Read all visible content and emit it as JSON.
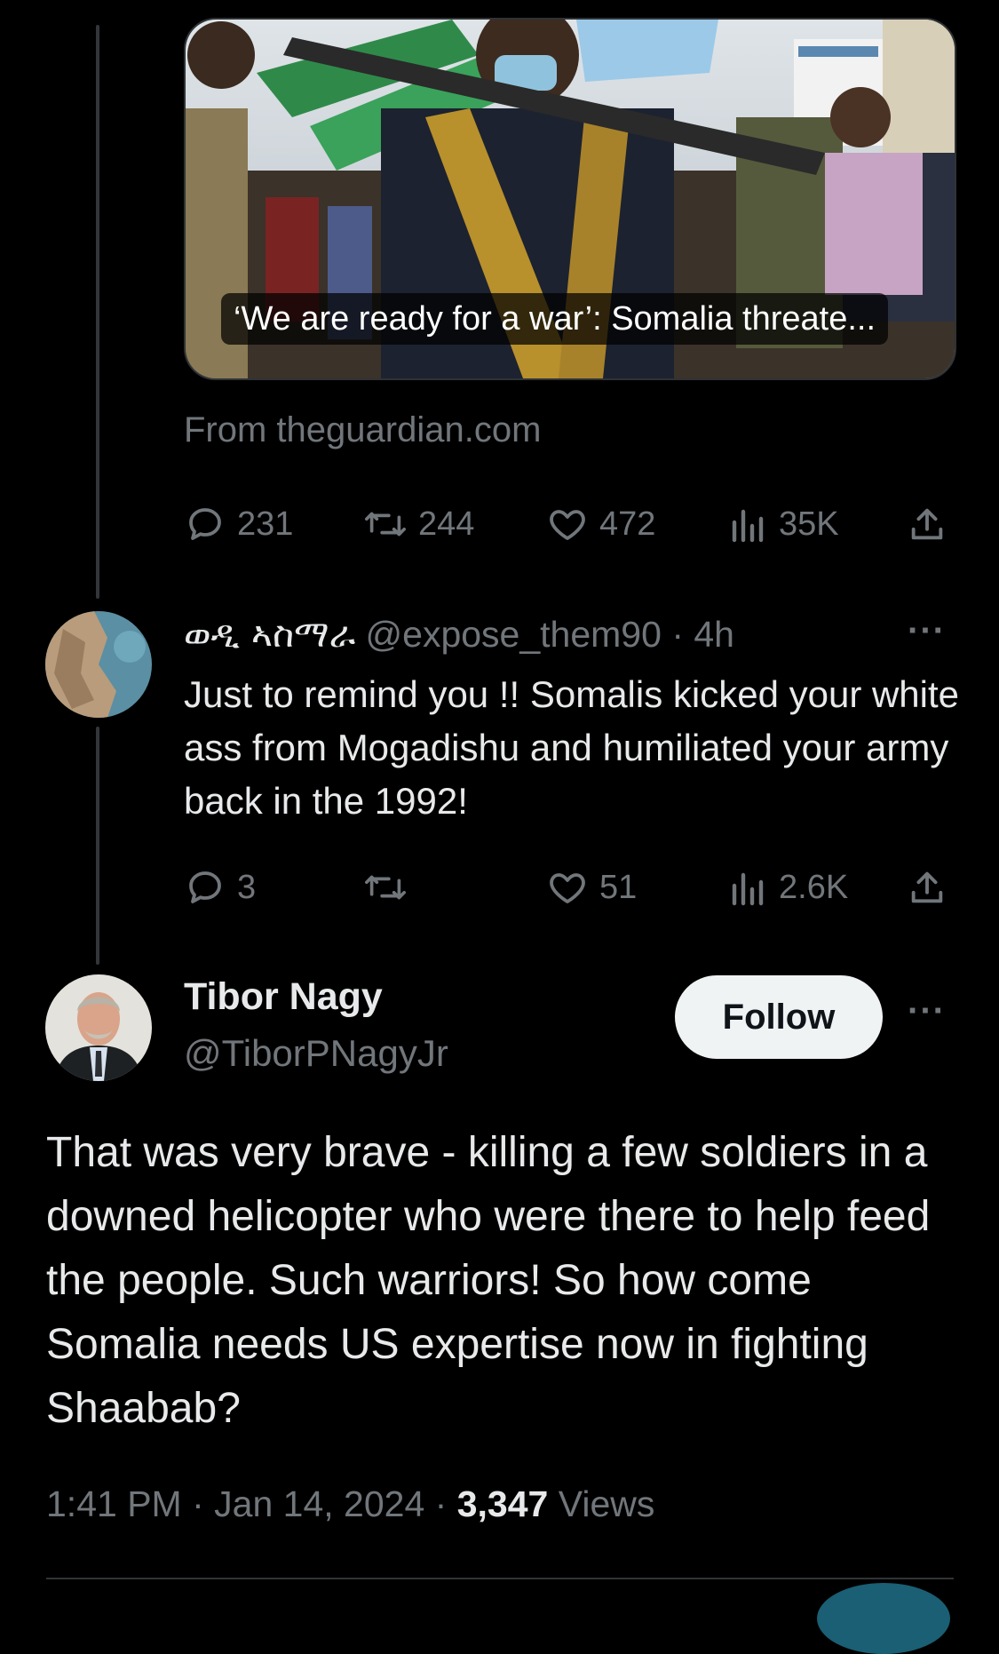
{
  "link_card": {
    "headline": "‘We are ready for a war’: Somalia threate...",
    "source": "From theguardian.com"
  },
  "parent_tweet": {
    "stats": {
      "replies": "231",
      "retweets": "244",
      "likes": "472",
      "views": "35K"
    }
  },
  "reply": {
    "display_name": "ወዲ ኣስማራ",
    "handle": "@expose_them90",
    "time": "· 4h",
    "text": "Just to remind you !! Somalis kicked your white ass from Mogadishu and humiliated your army back in the 1992!",
    "stats": {
      "replies": "3",
      "retweets": "",
      "likes": "51",
      "views": "2.6K"
    }
  },
  "main_tweet": {
    "author_name": "Tibor Nagy",
    "author_handle": "@TiborPNagyJr",
    "follow_label": "Follow",
    "text": "That was very brave - killing a few soldiers in a downed helicopter who were there to help feed the people.  Such warriors!  So how come Somalia needs US expertise now in fighting Shaabab?",
    "time": "1:41 PM",
    "date": "Jan 14, 2024",
    "views_count": "3,347",
    "views_label": "Views"
  },
  "icons": {
    "reply": "reply-icon",
    "retweet": "retweet-icon",
    "like": "heart-icon",
    "views": "views-icon",
    "share": "share-icon",
    "more": "more-icon"
  },
  "colors": {
    "background": "#000000",
    "text_primary": "#e7e9ea",
    "text_secondary": "#71767b",
    "border": "#2f3336",
    "follow_bg": "#eff3f4"
  }
}
